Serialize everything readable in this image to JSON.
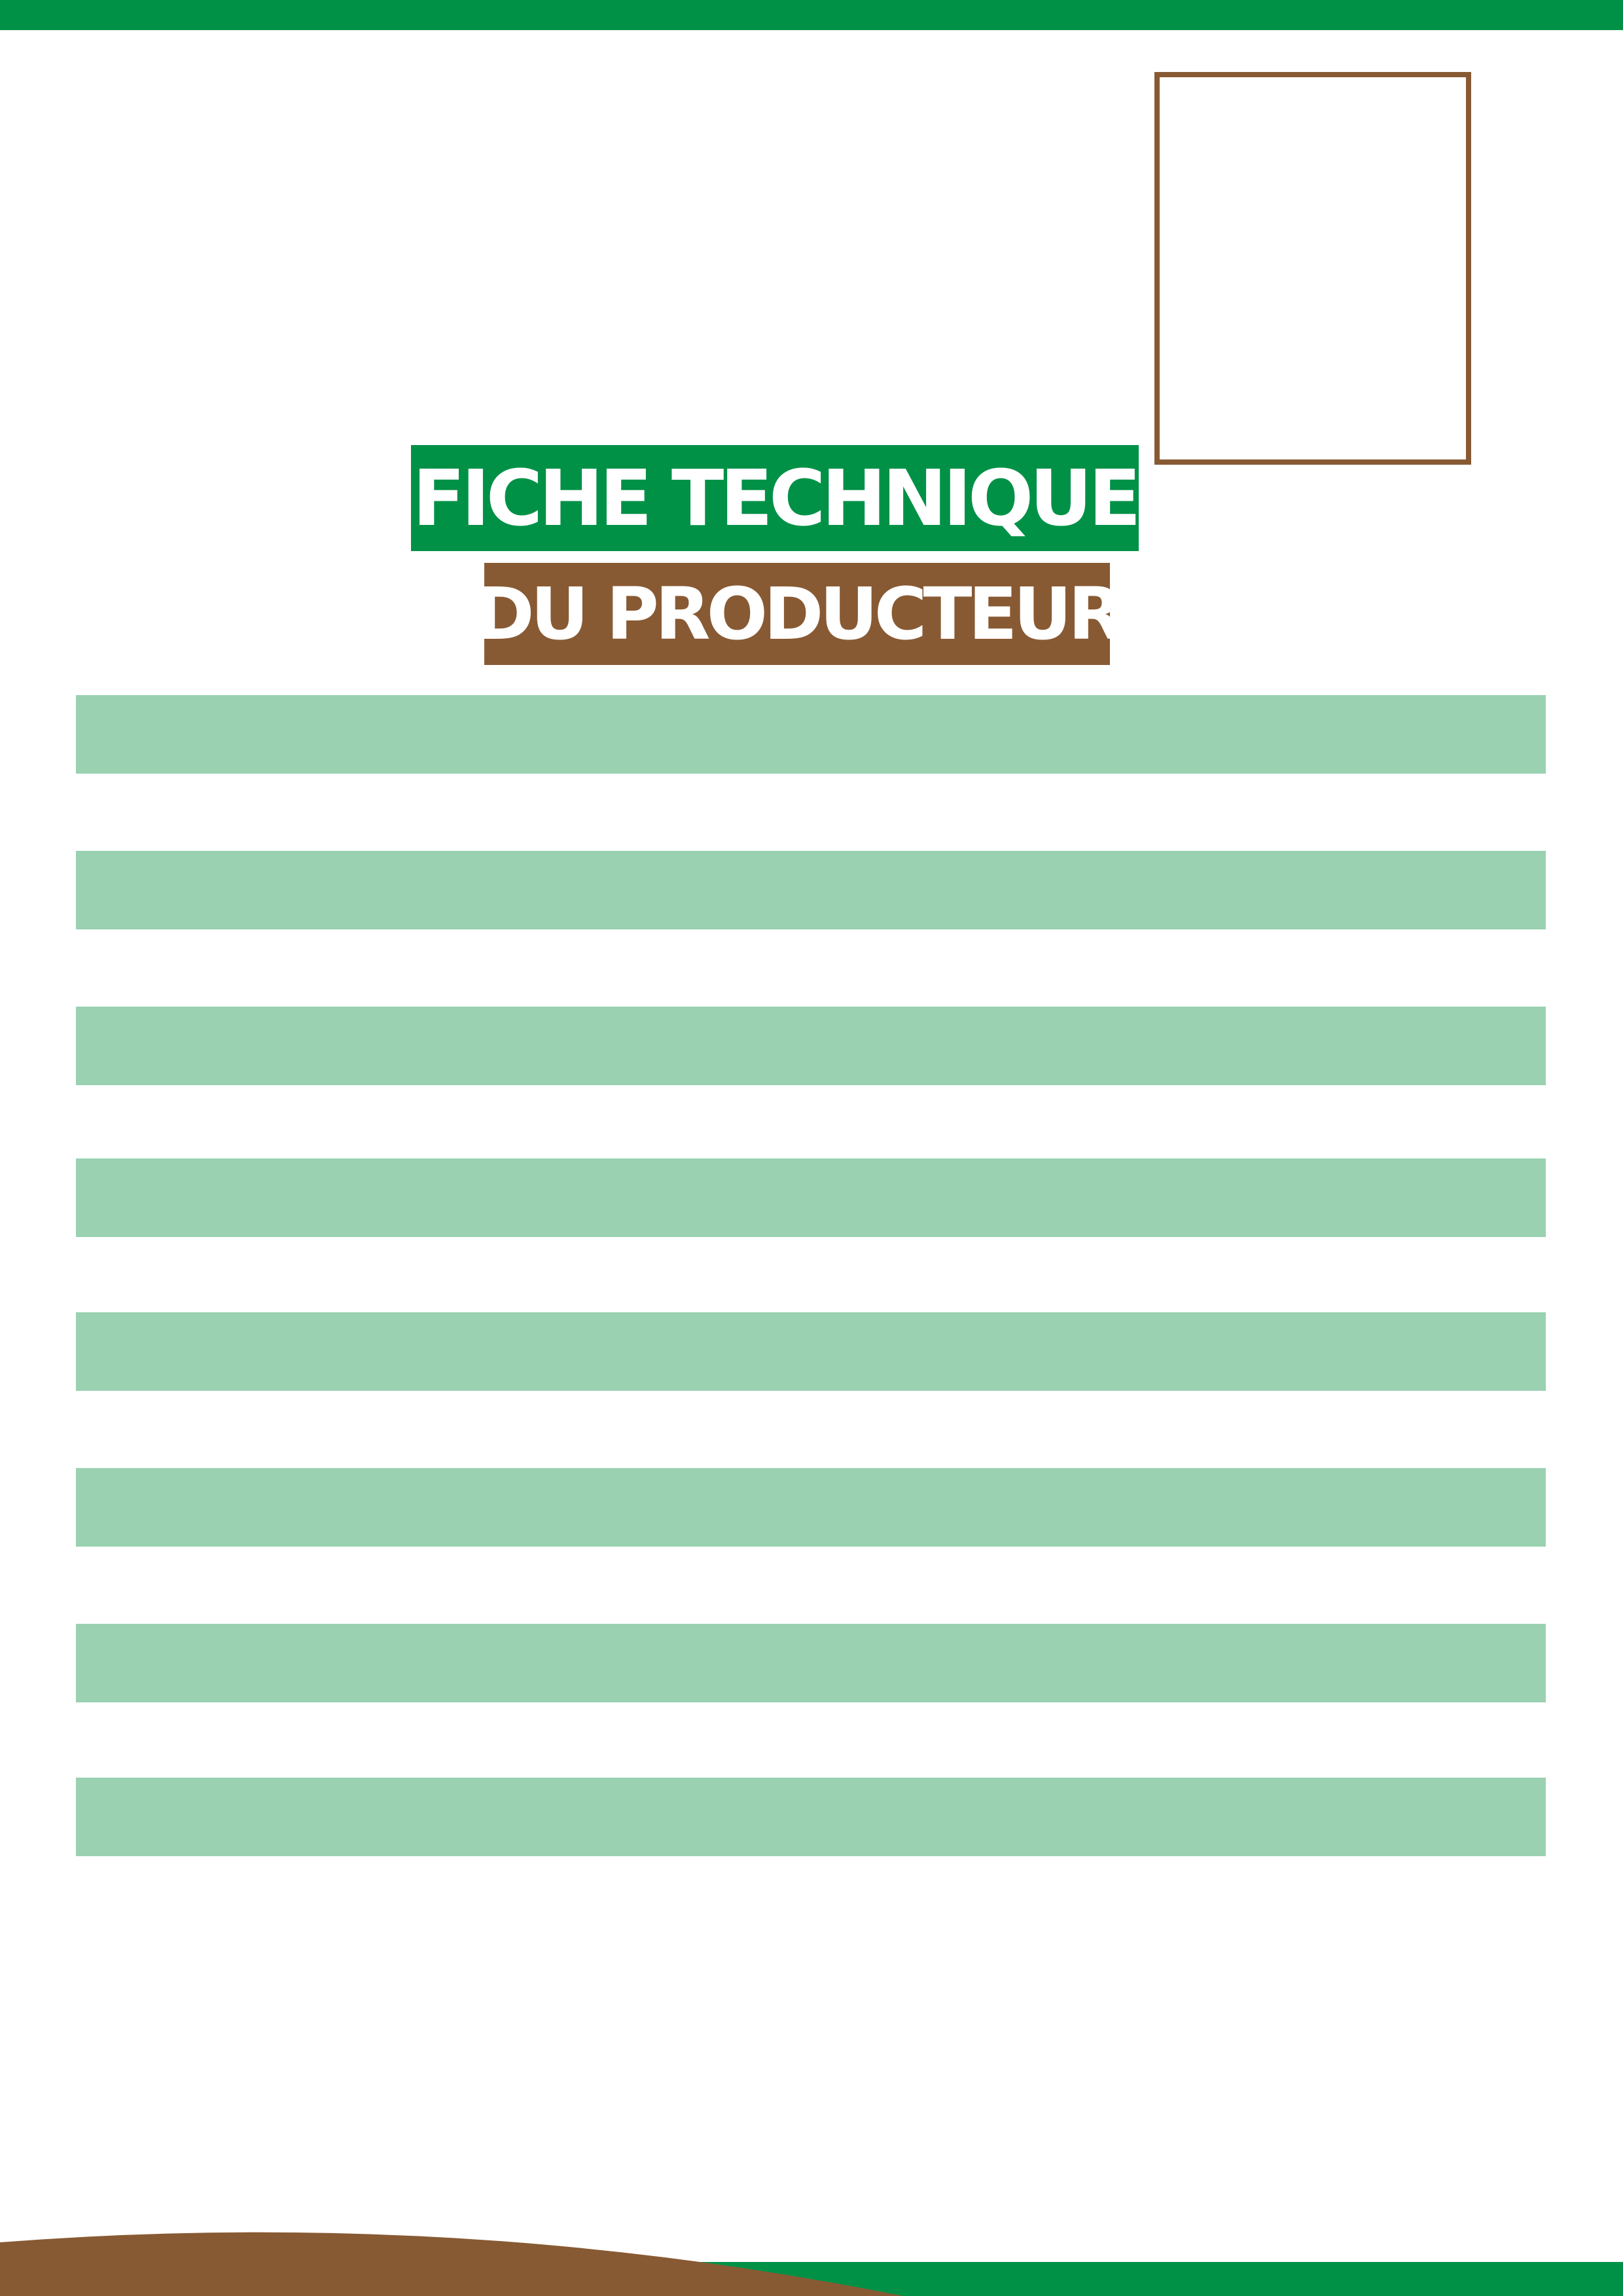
{
  "colors": {
    "green": "#009147",
    "brown": "#885a33",
    "light_green": "#99d1b1"
  },
  "photo_placeholder": {
    "border_color": "#885a33"
  },
  "title": {
    "line1": "FICHE TECHNIQUE",
    "line2": "DU PRODUCTEUR"
  },
  "form": {
    "field_count": 8
  }
}
